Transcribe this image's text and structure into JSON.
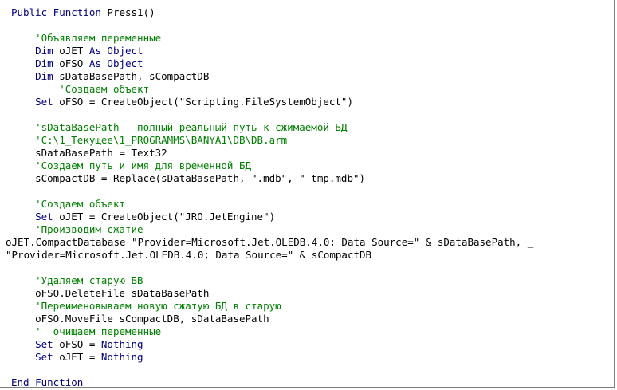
{
  "editor": {
    "language": "Visual Basic",
    "colors": {
      "keyword": "#00007f",
      "comment": "#007f00",
      "text": "#000000",
      "background": "#ffffff"
    },
    "lines": [
      {
        "indent": 0,
        "tokens": [
          {
            "t": "kw",
            "v": "Public Function"
          },
          {
            "t": "tx",
            "v": " Press1()"
          }
        ]
      },
      {
        "indent": 0,
        "tokens": []
      },
      {
        "indent": 4,
        "tokens": [
          {
            "t": "cm",
            "v": "'Объявляем переменные"
          }
        ]
      },
      {
        "indent": 4,
        "tokens": [
          {
            "t": "kw",
            "v": "Dim"
          },
          {
            "t": "tx",
            "v": " oJET "
          },
          {
            "t": "kw",
            "v": "As Object"
          }
        ]
      },
      {
        "indent": 4,
        "tokens": [
          {
            "t": "kw",
            "v": "Dim"
          },
          {
            "t": "tx",
            "v": " oFSO "
          },
          {
            "t": "kw",
            "v": "As Object"
          }
        ]
      },
      {
        "indent": 4,
        "tokens": [
          {
            "t": "kw",
            "v": "Dim"
          },
          {
            "t": "tx",
            "v": " sDataBasePath, sCompactDB"
          }
        ]
      },
      {
        "indent": 8,
        "tokens": [
          {
            "t": "cm",
            "v": "'Создаем объект"
          }
        ]
      },
      {
        "indent": 4,
        "tokens": [
          {
            "t": "kw",
            "v": "Set"
          },
          {
            "t": "tx",
            "v": " oFSO = CreateObject(\"Scripting.FileSystemObject\")"
          }
        ]
      },
      {
        "indent": 0,
        "tokens": []
      },
      {
        "indent": 4,
        "tokens": [
          {
            "t": "cm",
            "v": "'sDataBasePath - полный реальный путь к сжимаемой БД"
          }
        ]
      },
      {
        "indent": 4,
        "tokens": [
          {
            "t": "cm",
            "v": "'C:\\1_Текущее\\1_PROGRAMMS\\BANYA1\\DB\\DB.arm"
          }
        ]
      },
      {
        "indent": 4,
        "tokens": [
          {
            "t": "tx",
            "v": "sDataBasePath = Text32"
          }
        ]
      },
      {
        "indent": 4,
        "tokens": [
          {
            "t": "cm",
            "v": "'Создаем путь и имя для временной БД"
          }
        ]
      },
      {
        "indent": 4,
        "tokens": [
          {
            "t": "tx",
            "v": "sCompactDB = Replace(sDataBasePath, \".mdb\", \"-tmp.mdb\")"
          }
        ]
      },
      {
        "indent": 0,
        "tokens": []
      },
      {
        "indent": 4,
        "tokens": [
          {
            "t": "cm",
            "v": "'Создаем объект"
          }
        ]
      },
      {
        "indent": 4,
        "tokens": [
          {
            "t": "kw",
            "v": "Set"
          },
          {
            "t": "tx",
            "v": " oJET = CreateObject(\"JRO.JetEngine\")"
          }
        ]
      },
      {
        "indent": 4,
        "tokens": [
          {
            "t": "cm",
            "v": "'Производим сжатие"
          }
        ]
      },
      {
        "indent": -1,
        "tokens": [
          {
            "t": "tx",
            "v": "oJET.CompactDatabase \"Provider=Microsoft.Jet.OLEDB.4.0; Data Source=\" & sDataBasePath, _"
          }
        ]
      },
      {
        "indent": -1,
        "tokens": [
          {
            "t": "tx",
            "v": "\"Provider=Microsoft.Jet.OLEDB.4.0; Data Source=\" & sCompactDB"
          }
        ]
      },
      {
        "indent": 0,
        "tokens": []
      },
      {
        "indent": 4,
        "tokens": [
          {
            "t": "cm",
            "v": "'Удаляем старую БВ"
          }
        ]
      },
      {
        "indent": 4,
        "tokens": [
          {
            "t": "tx",
            "v": "oFSO.DeleteFile sDataBasePath"
          }
        ]
      },
      {
        "indent": 4,
        "tokens": [
          {
            "t": "cm",
            "v": "'Переименовываем новую сжатую БД в старую"
          }
        ]
      },
      {
        "indent": 4,
        "tokens": [
          {
            "t": "tx",
            "v": "oFSO.MoveFile sCompactDB, sDataBasePath"
          }
        ]
      },
      {
        "indent": 4,
        "tokens": [
          {
            "t": "cm",
            "v": "'  очищаем переменные"
          }
        ]
      },
      {
        "indent": 4,
        "tokens": [
          {
            "t": "kw",
            "v": "Set"
          },
          {
            "t": "tx",
            "v": " oFSO = "
          },
          {
            "t": "kw",
            "v": "Nothing"
          }
        ]
      },
      {
        "indent": 4,
        "tokens": [
          {
            "t": "kw",
            "v": "Set"
          },
          {
            "t": "tx",
            "v": " oJET = "
          },
          {
            "t": "kw",
            "v": "Nothing"
          }
        ]
      },
      {
        "indent": 0,
        "tokens": []
      },
      {
        "indent": 0,
        "tokens": [
          {
            "t": "kw",
            "v": "End Function"
          }
        ]
      }
    ]
  }
}
